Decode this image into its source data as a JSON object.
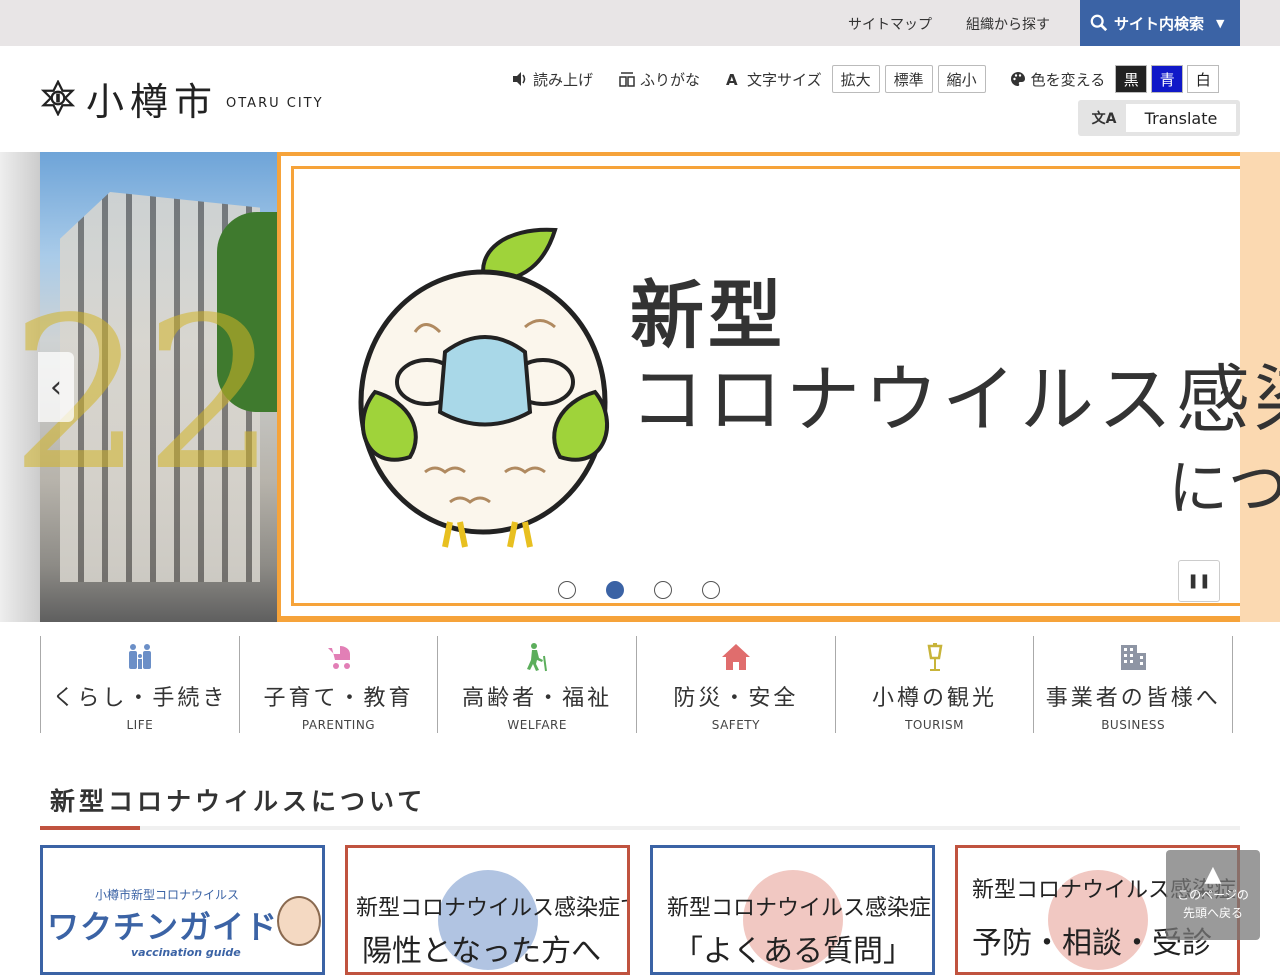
{
  "topbar": {
    "sitemap": "サイトマップ",
    "org_search": "組織から探す",
    "site_search": "サイト内検索"
  },
  "header": {
    "logo_jp": "小樽市",
    "logo_en": "OTARU CITY",
    "read_aloud": "読み上げ",
    "furigana": "ふりがな",
    "font_size_label": "文字サイズ",
    "size_large": "拡大",
    "size_normal": "標準",
    "size_small": "縮小",
    "color_label": "色を変える",
    "color_black": "黒",
    "color_blue": "青",
    "color_white": "白",
    "translate": "Translate",
    "translate_icon": "文A"
  },
  "hero": {
    "headline_1": "新型",
    "headline_2": "コロナウイルス感染",
    "headline_3": "につ",
    "ghost_text": "22",
    "prev_icon": "‹",
    "next_icon": "›",
    "pause_icon": "❚❚",
    "slide_count": 4,
    "active_slide": 2
  },
  "categories": [
    {
      "jp": "くらし・手続き",
      "en": "LIFE",
      "icon": "family-icon",
      "color": "#6b8fc7"
    },
    {
      "jp": "子育て・教育",
      "en": "PARENTING",
      "icon": "stroller-icon",
      "color": "#e27fb6"
    },
    {
      "jp": "高齢者・福祉",
      "en": "WELFARE",
      "icon": "elderly-walker-icon",
      "color": "#5cae5c"
    },
    {
      "jp": "防災・安全",
      "en": "SAFETY",
      "icon": "house-icon",
      "color": "#e06d6d"
    },
    {
      "jp": "小樽の観光",
      "en": "TOURISM",
      "icon": "gas-lamp-icon",
      "color": "#c8b43a"
    },
    {
      "jp": "事業者の皆様へ",
      "en": "BUSINESS",
      "icon": "building-icon",
      "color": "#8e95a4"
    }
  ],
  "section": {
    "title": "新型コロナウイルスについて"
  },
  "cards": [
    {
      "kicker": "小樽市新型コロナウイルス",
      "title": "ワクチンガイド",
      "subtitle": "vaccination guide"
    },
    {
      "line1": "新型コロナウイルス感染症で",
      "line2": "陽性となった方へ"
    },
    {
      "line1": "新型コロナウイルス感染症",
      "line2": "「よくある質問」"
    },
    {
      "line1": "新型コロナウイルス感染症",
      "line2": "予防・相談・受診"
    }
  ],
  "back_to_top": {
    "label_1": "このページの",
    "label_2": "先頭へ戻る"
  },
  "colors": {
    "accent_blue": "#3b63a5",
    "accent_orange": "#f6a33a",
    "accent_red": "#c0533f"
  }
}
